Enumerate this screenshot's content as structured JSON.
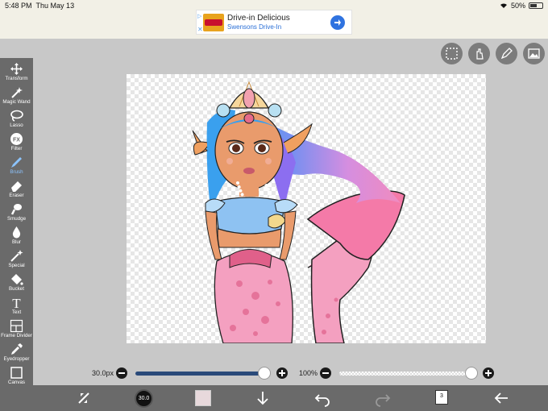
{
  "status_bar": {
    "time": "5:48 PM",
    "date": "Thu May 13",
    "battery": "50%",
    "battery_level": 0.5
  },
  "ad": {
    "brand": "Swensons",
    "title": "Drive-in Delicious",
    "subtitle": "Swensons Drive-In",
    "close": "✕"
  },
  "toolbar": {
    "tools": [
      {
        "label": "Transform",
        "icon": "move-icon"
      },
      {
        "label": "Magic Wand",
        "icon": "magic-wand-icon"
      },
      {
        "label": "Lasso",
        "icon": "lasso-icon"
      },
      {
        "label": "Filter",
        "icon": "fx-icon",
        "glyph": "FX"
      },
      {
        "label": "Brush",
        "icon": "brush-icon",
        "active": true
      },
      {
        "label": "Eraser",
        "icon": "eraser-icon"
      },
      {
        "label": "Smudge",
        "icon": "smudge-icon"
      },
      {
        "label": "Blur",
        "icon": "drop-icon"
      },
      {
        "label": "Special",
        "icon": "sparkle-pen-icon"
      },
      {
        "label": "Bucket",
        "icon": "bucket-icon"
      },
      {
        "label": "Text",
        "icon": "text-icon",
        "glyph": "T"
      },
      {
        "label": "Frame Divider",
        "icon": "frame-divider-icon"
      },
      {
        "label": "Eyedropper",
        "icon": "eyedropper-icon"
      },
      {
        "label": "Canvas",
        "icon": "canvas-icon"
      }
    ]
  },
  "sliders": {
    "brush_size": {
      "label": "30.0px",
      "fraction": 1.0
    },
    "opacity": {
      "label": "100%",
      "fraction": 1.0
    }
  },
  "bottom_bar": {
    "brush_size_value": "30.0",
    "layer_count": "3",
    "current_color": "#e8d9dc"
  },
  "colors": {
    "toolbar_bg": "#6a6a6a",
    "active_tool": "#8cc4ff",
    "slider_fill": "#2a4a7a",
    "workspace_bg": "#c8c8c8"
  }
}
